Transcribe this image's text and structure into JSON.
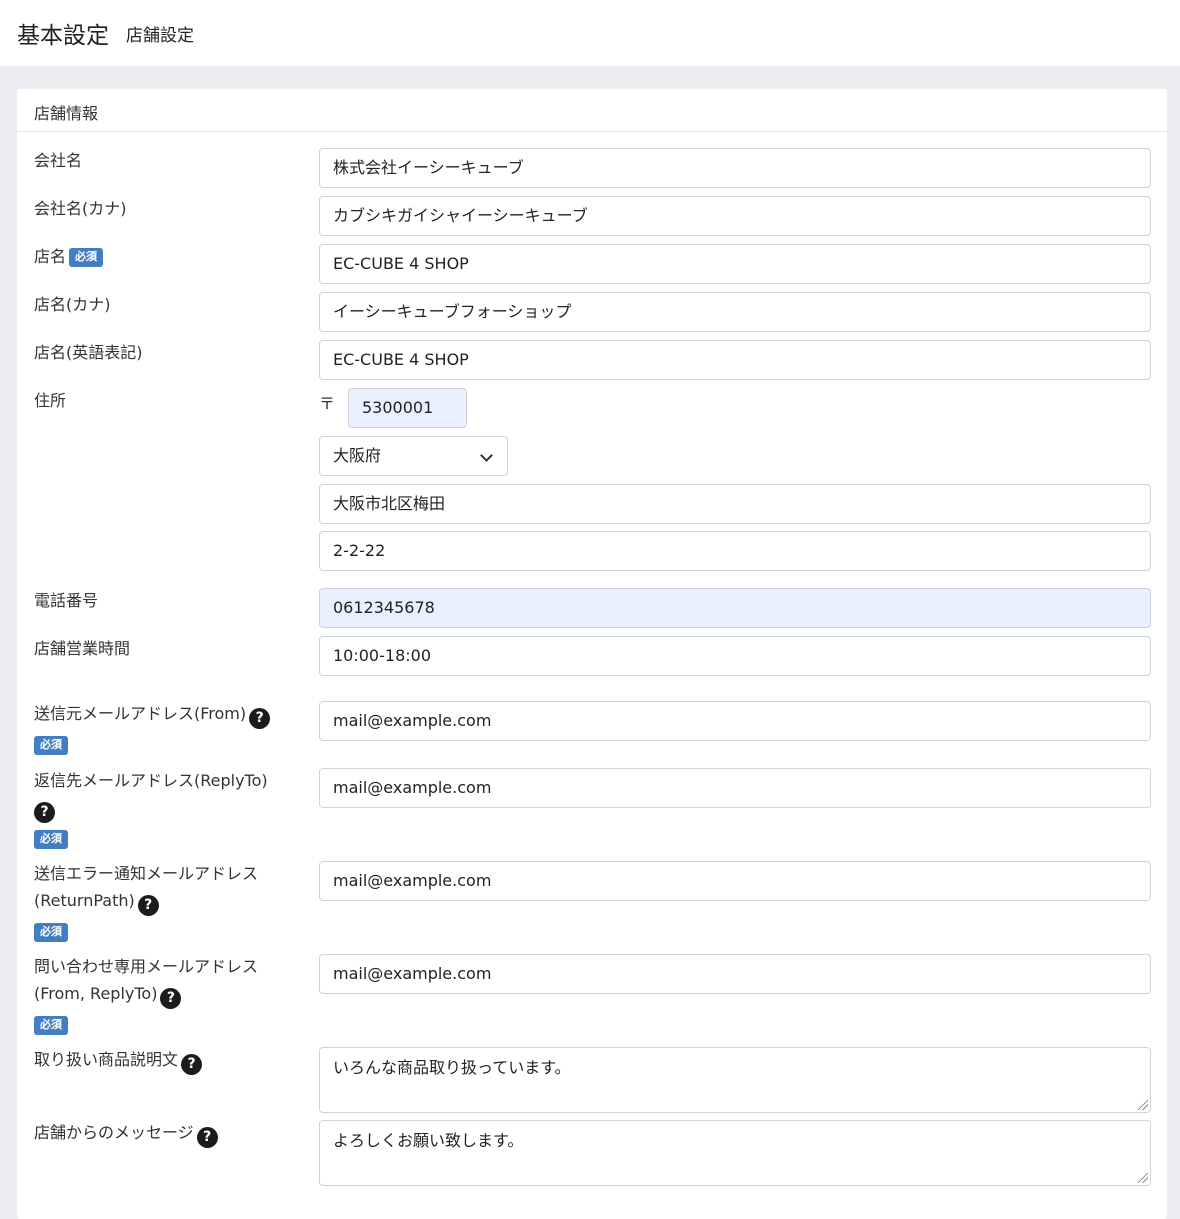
{
  "header": {
    "title": "基本設定",
    "subtitle": "店舗設定"
  },
  "card": {
    "title": "店舗情報"
  },
  "required_label": "必須",
  "help_glyph": "?",
  "fields": {
    "company_name": {
      "label": "会社名",
      "value": "株式会社イーシーキューブ"
    },
    "company_kana": {
      "label": "会社名(カナ)",
      "value": "カブシキガイシャイーシーキューブ"
    },
    "shop_name": {
      "label": "店名",
      "value": "EC-CUBE 4 SHOP"
    },
    "shop_kana": {
      "label": "店名(カナ)",
      "value": "イーシーキューブフォーショップ"
    },
    "shop_en": {
      "label": "店名(英語表記)",
      "value": "EC-CUBE 4 SHOP"
    },
    "address": {
      "label": "住所",
      "zip_mark": "〒",
      "zip": "5300001",
      "pref": "大阪府",
      "addr01": "大阪市北区梅田",
      "addr02": "2-2-22"
    },
    "phone": {
      "label": "電話番号",
      "value": "0612345678"
    },
    "hours": {
      "label": "店舗営業時間",
      "value": "10:00-18:00"
    },
    "email_from": {
      "label": "送信元メールアドレス(From)",
      "value": "mail@example.com"
    },
    "email_reply": {
      "label": "返信先メールアドレス(ReplyTo)",
      "value": "mail@example.com"
    },
    "email_return": {
      "label_line1": "送信エラー通知メールアドレス",
      "label_line2": "(ReturnPath)",
      "value": "mail@example.com"
    },
    "email_contact": {
      "label_line1": "問い合わせ専用メールアドレス",
      "label_line2": "(From, ReplyTo)",
      "value": "mail@example.com"
    },
    "good_traded": {
      "label": "取り扱い商品説明文",
      "value": "いろんな商品取り扱っています。"
    },
    "message": {
      "label": "店舗からのメッセージ",
      "value": "よろしくお願い致します。"
    }
  }
}
